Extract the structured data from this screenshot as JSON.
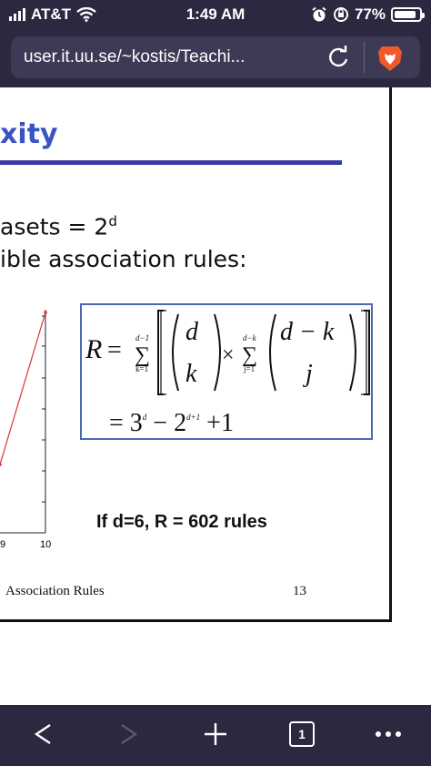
{
  "status_bar": {
    "carrier": "AT&T",
    "time": "1:49 AM",
    "battery": "77%",
    "battery_level": 0.77
  },
  "browser": {
    "url": "user.it.uu.se/~kostis/Teachi..."
  },
  "slide": {
    "title": "xity",
    "line1": "asets = 2",
    "line1_sup": "d",
    "line2": "ible association rules:",
    "formula": {
      "R": "R",
      "eq": "=",
      "sum1_top": "d−1",
      "sum1_bottom": "k=1",
      "binom1_top": "d",
      "binom1_bottom": "k",
      "times": "×",
      "sum2_top": "d−k",
      "sum2_bottom": "j=1",
      "binom2_top": "d − k",
      "binom2_bottom": "j",
      "line2": "= 3",
      "line2_sup1": "d",
      "line2_mid": " − 2",
      "line2_sup2": "d+1",
      "line2_end": " +1"
    },
    "plot_ticks": [
      "9",
      "10"
    ],
    "rule_text": "If d=6,  R = 602 rules",
    "footer_left": "Association Rules",
    "footer_right": "13"
  },
  "toolbar": {
    "tab_count": "1",
    "colors": {
      "bar": "#2b2940",
      "icon": "#ffffff",
      "icon_disabled": "#5a5878"
    }
  }
}
